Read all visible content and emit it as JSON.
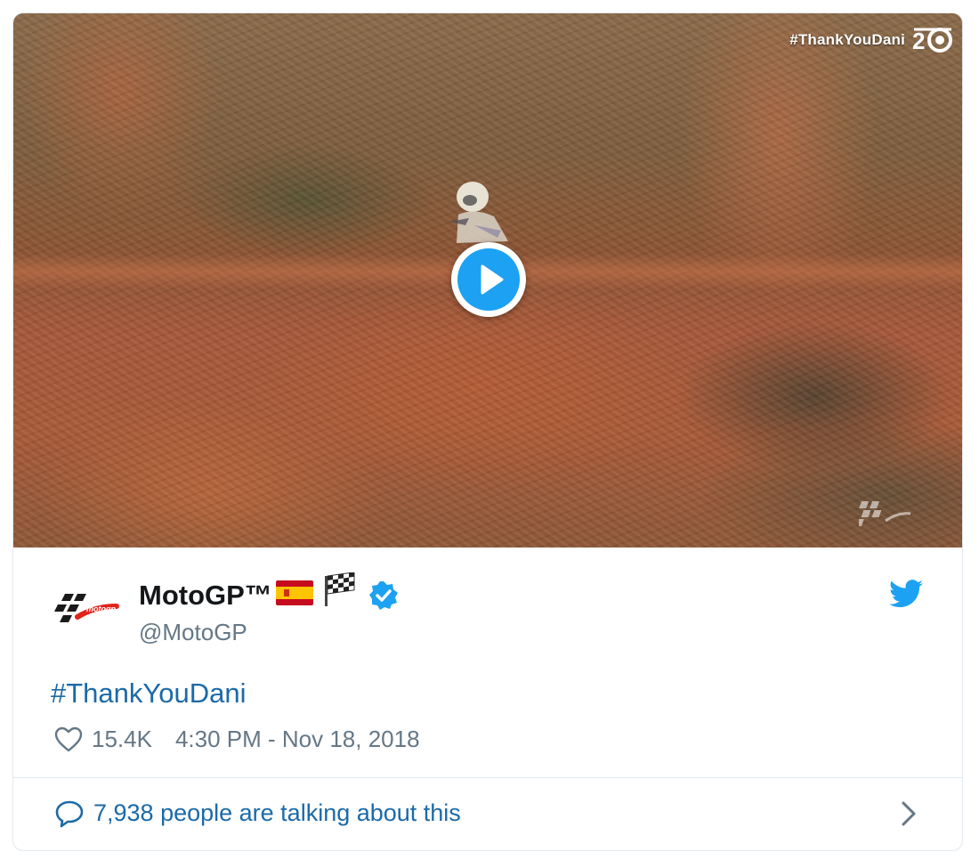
{
  "video": {
    "overlay_hashtag": "#ThankYouDani",
    "play_icon": "play-icon",
    "badge_icon": "anniversary-badge-icon",
    "watermark_icon": "motogp-logo-icon"
  },
  "tweet": {
    "display_name": "MotoGP™",
    "name_emojis": [
      "spain-flag-icon",
      "checkered-flag-icon"
    ],
    "verified_icon": "verified-badge-icon",
    "handle": "@MotoGP",
    "text": "#ThankYouDani",
    "likes": "15.4K",
    "timestamp": "4:30 PM - Nov 18, 2018",
    "brand_icon": "twitter-bird-icon"
  },
  "footer": {
    "conversation_text": "7,938 people are talking about this",
    "icon": "speech-bubble-icon",
    "arrow_icon": "chevron-right-icon"
  },
  "colors": {
    "twitter_blue": "#1da1f2",
    "link_blue": "#1b6aa8",
    "text_dark": "#14171a",
    "text_grey": "#657786",
    "motogp_red": "#e2231a"
  }
}
